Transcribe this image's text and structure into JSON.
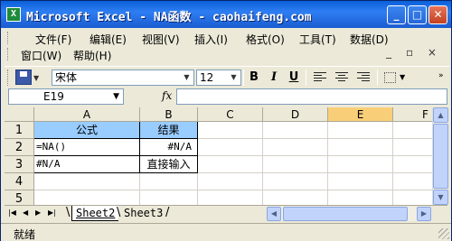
{
  "window": {
    "title": "Microsoft Excel - NA函数 - caohaifeng.com",
    "icon": "excel-icon",
    "min_label": "_",
    "max_label": "□",
    "close_label": "✕"
  },
  "menubar": {
    "row1": [
      {
        "label": "文件(F)"
      },
      {
        "label": "编辑(E)"
      },
      {
        "label": "视图(V)"
      },
      {
        "label": "插入(I)"
      },
      {
        "label": "格式(O)"
      },
      {
        "label": "工具(T)"
      },
      {
        "label": "数据(D)"
      }
    ],
    "row2": [
      {
        "label": "窗口(W)"
      },
      {
        "label": "帮助(H)"
      }
    ],
    "mdi_controls": "_ ▫ ×"
  },
  "toolbar": {
    "font_name": "宋体",
    "font_size": "12",
    "bold_label": "B",
    "italic_label": "I",
    "underline_label": "U"
  },
  "formula_bar": {
    "name_box": "E19",
    "fx_label": "fx",
    "formula": ""
  },
  "grid": {
    "columns": [
      "A",
      "B",
      "C",
      "D",
      "E",
      "F"
    ],
    "active_column": "E",
    "rows": [
      "1",
      "2",
      "3",
      "4",
      "5"
    ],
    "cells": {
      "A1": "公式",
      "B1": "结果",
      "A2": "=NA()",
      "B2": "#N/A",
      "A3": "#N/A",
      "B3": "直接输入"
    }
  },
  "sheet_tabs": {
    "nav": [
      "|◀",
      "◀",
      "▶",
      "▶|"
    ],
    "tabs": [
      {
        "label": "Sheet2",
        "active": true
      },
      {
        "label": "Sheet3",
        "active": false
      }
    ]
  },
  "status_bar": {
    "text": "就绪"
  },
  "colors": {
    "title_bar": "#2f7ef3",
    "header_fill": "#99ccff",
    "active_col_header": "#f8cf78",
    "chrome": "#ece9d8"
  }
}
